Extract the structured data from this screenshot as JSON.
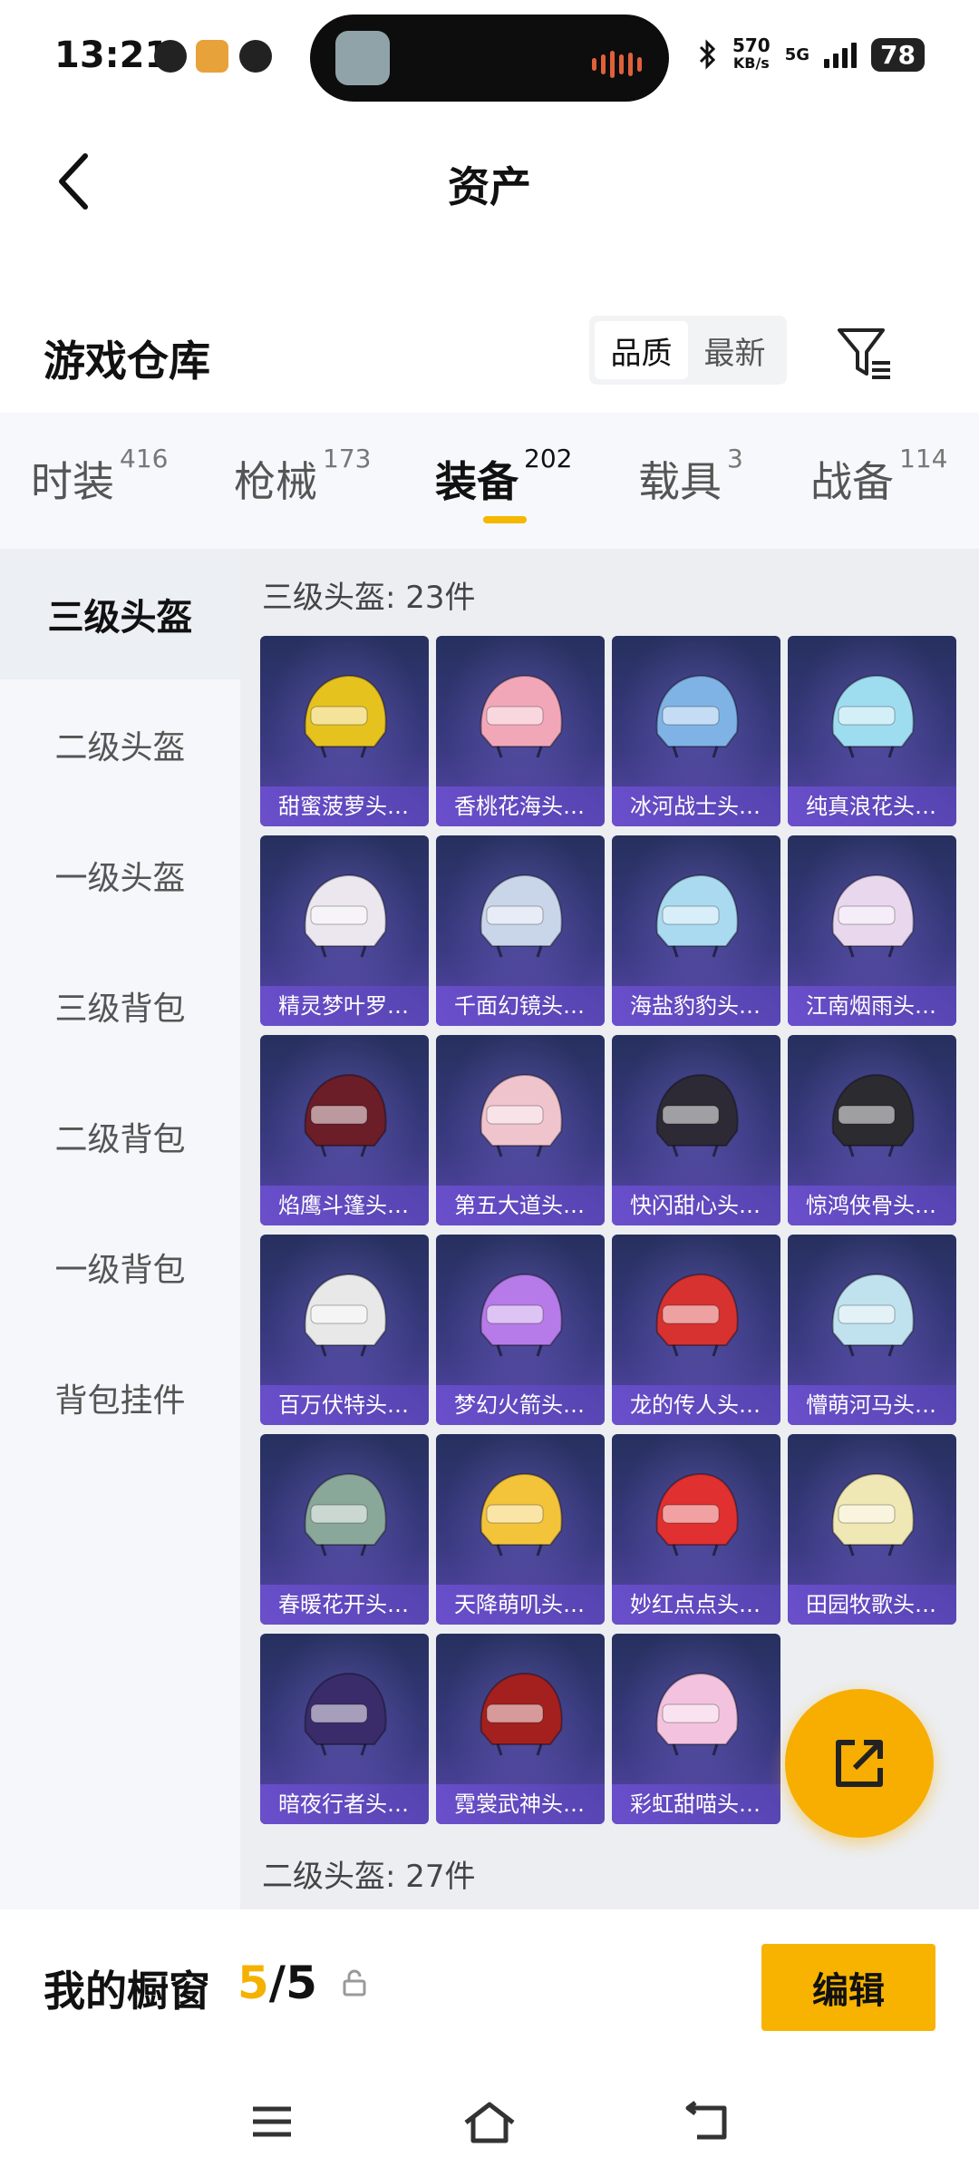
{
  "status_bar": {
    "time": "13:21",
    "net_speed_value": "570",
    "net_speed_unit": "KB/s",
    "network": "5G",
    "battery": "78"
  },
  "nav": {
    "title": "资产"
  },
  "warehouse": {
    "title": "游戏仓库",
    "sort_options": [
      "品质",
      "最新"
    ],
    "active_sort": "品质"
  },
  "category_tabs": [
    {
      "label": "时装",
      "count": "416"
    },
    {
      "label": "枪械",
      "count": "173"
    },
    {
      "label": "装备",
      "count": "202"
    },
    {
      "label": "载具",
      "count": "3"
    },
    {
      "label": "战备",
      "count": "114"
    }
  ],
  "active_category": "装备",
  "sidebar": {
    "items": [
      "三级头盔",
      "二级头盔",
      "一级头盔",
      "三级背包",
      "二级背包",
      "一级背包",
      "背包挂件"
    ],
    "active": "三级头盔"
  },
  "sections": [
    {
      "title": "三级头盔: 23件",
      "items": [
        {
          "name": "甜蜜菠萝头…",
          "color": "#e6c21e"
        },
        {
          "name": "香桃花海头…",
          "color": "#f2a7b8"
        },
        {
          "name": "冰河战士头…",
          "color": "#7fb3e6"
        },
        {
          "name": "纯真浪花头…",
          "color": "#9edcf0"
        },
        {
          "name": "精灵梦叶罗…",
          "color": "#ece7ef"
        },
        {
          "name": "千面幻镜头…",
          "color": "#c9d6ea"
        },
        {
          "name": "海盐豹豹头…",
          "color": "#a9daf0"
        },
        {
          "name": "江南烟雨头…",
          "color": "#e9d7ee"
        },
        {
          "name": "焰鹰斗篷头…",
          "color": "#6b1d28"
        },
        {
          "name": "第五大道头…",
          "color": "#f0c4cc"
        },
        {
          "name": "快闪甜心头…",
          "color": "#2d2a35"
        },
        {
          "name": "惊鸿侠骨头…",
          "color": "#2b2b30"
        },
        {
          "name": "百万伏特头…",
          "color": "#e8e8e8"
        },
        {
          "name": "梦幻火箭头…",
          "color": "#b67be8"
        },
        {
          "name": "龙的传人头…",
          "color": "#d7322f"
        },
        {
          "name": "懵萌河马头…",
          "color": "#bfe2ee"
        },
        {
          "name": "春暖花开头…",
          "color": "#8aa89a"
        },
        {
          "name": "天降萌叽头…",
          "color": "#f3c33a"
        },
        {
          "name": "妙红点点头…",
          "color": "#e03030"
        },
        {
          "name": "田园牧歌头…",
          "color": "#efe7b4"
        },
        {
          "name": "暗夜行者头…",
          "color": "#3a2c6a"
        },
        {
          "name": "霓裳武神头…",
          "color": "#a3201e"
        },
        {
          "name": "彩虹甜喵头…",
          "color": "#f3c2de"
        }
      ]
    },
    {
      "title": "二级头盔: 27件",
      "items": []
    }
  ],
  "showcase": {
    "label": "我的橱窗",
    "current": "5",
    "separator": "/",
    "total": "5",
    "edit_label": "编辑"
  },
  "colors": {
    "accent": "#f7b300",
    "card_top": "#26305e",
    "card_bottom": "#5947a8"
  }
}
